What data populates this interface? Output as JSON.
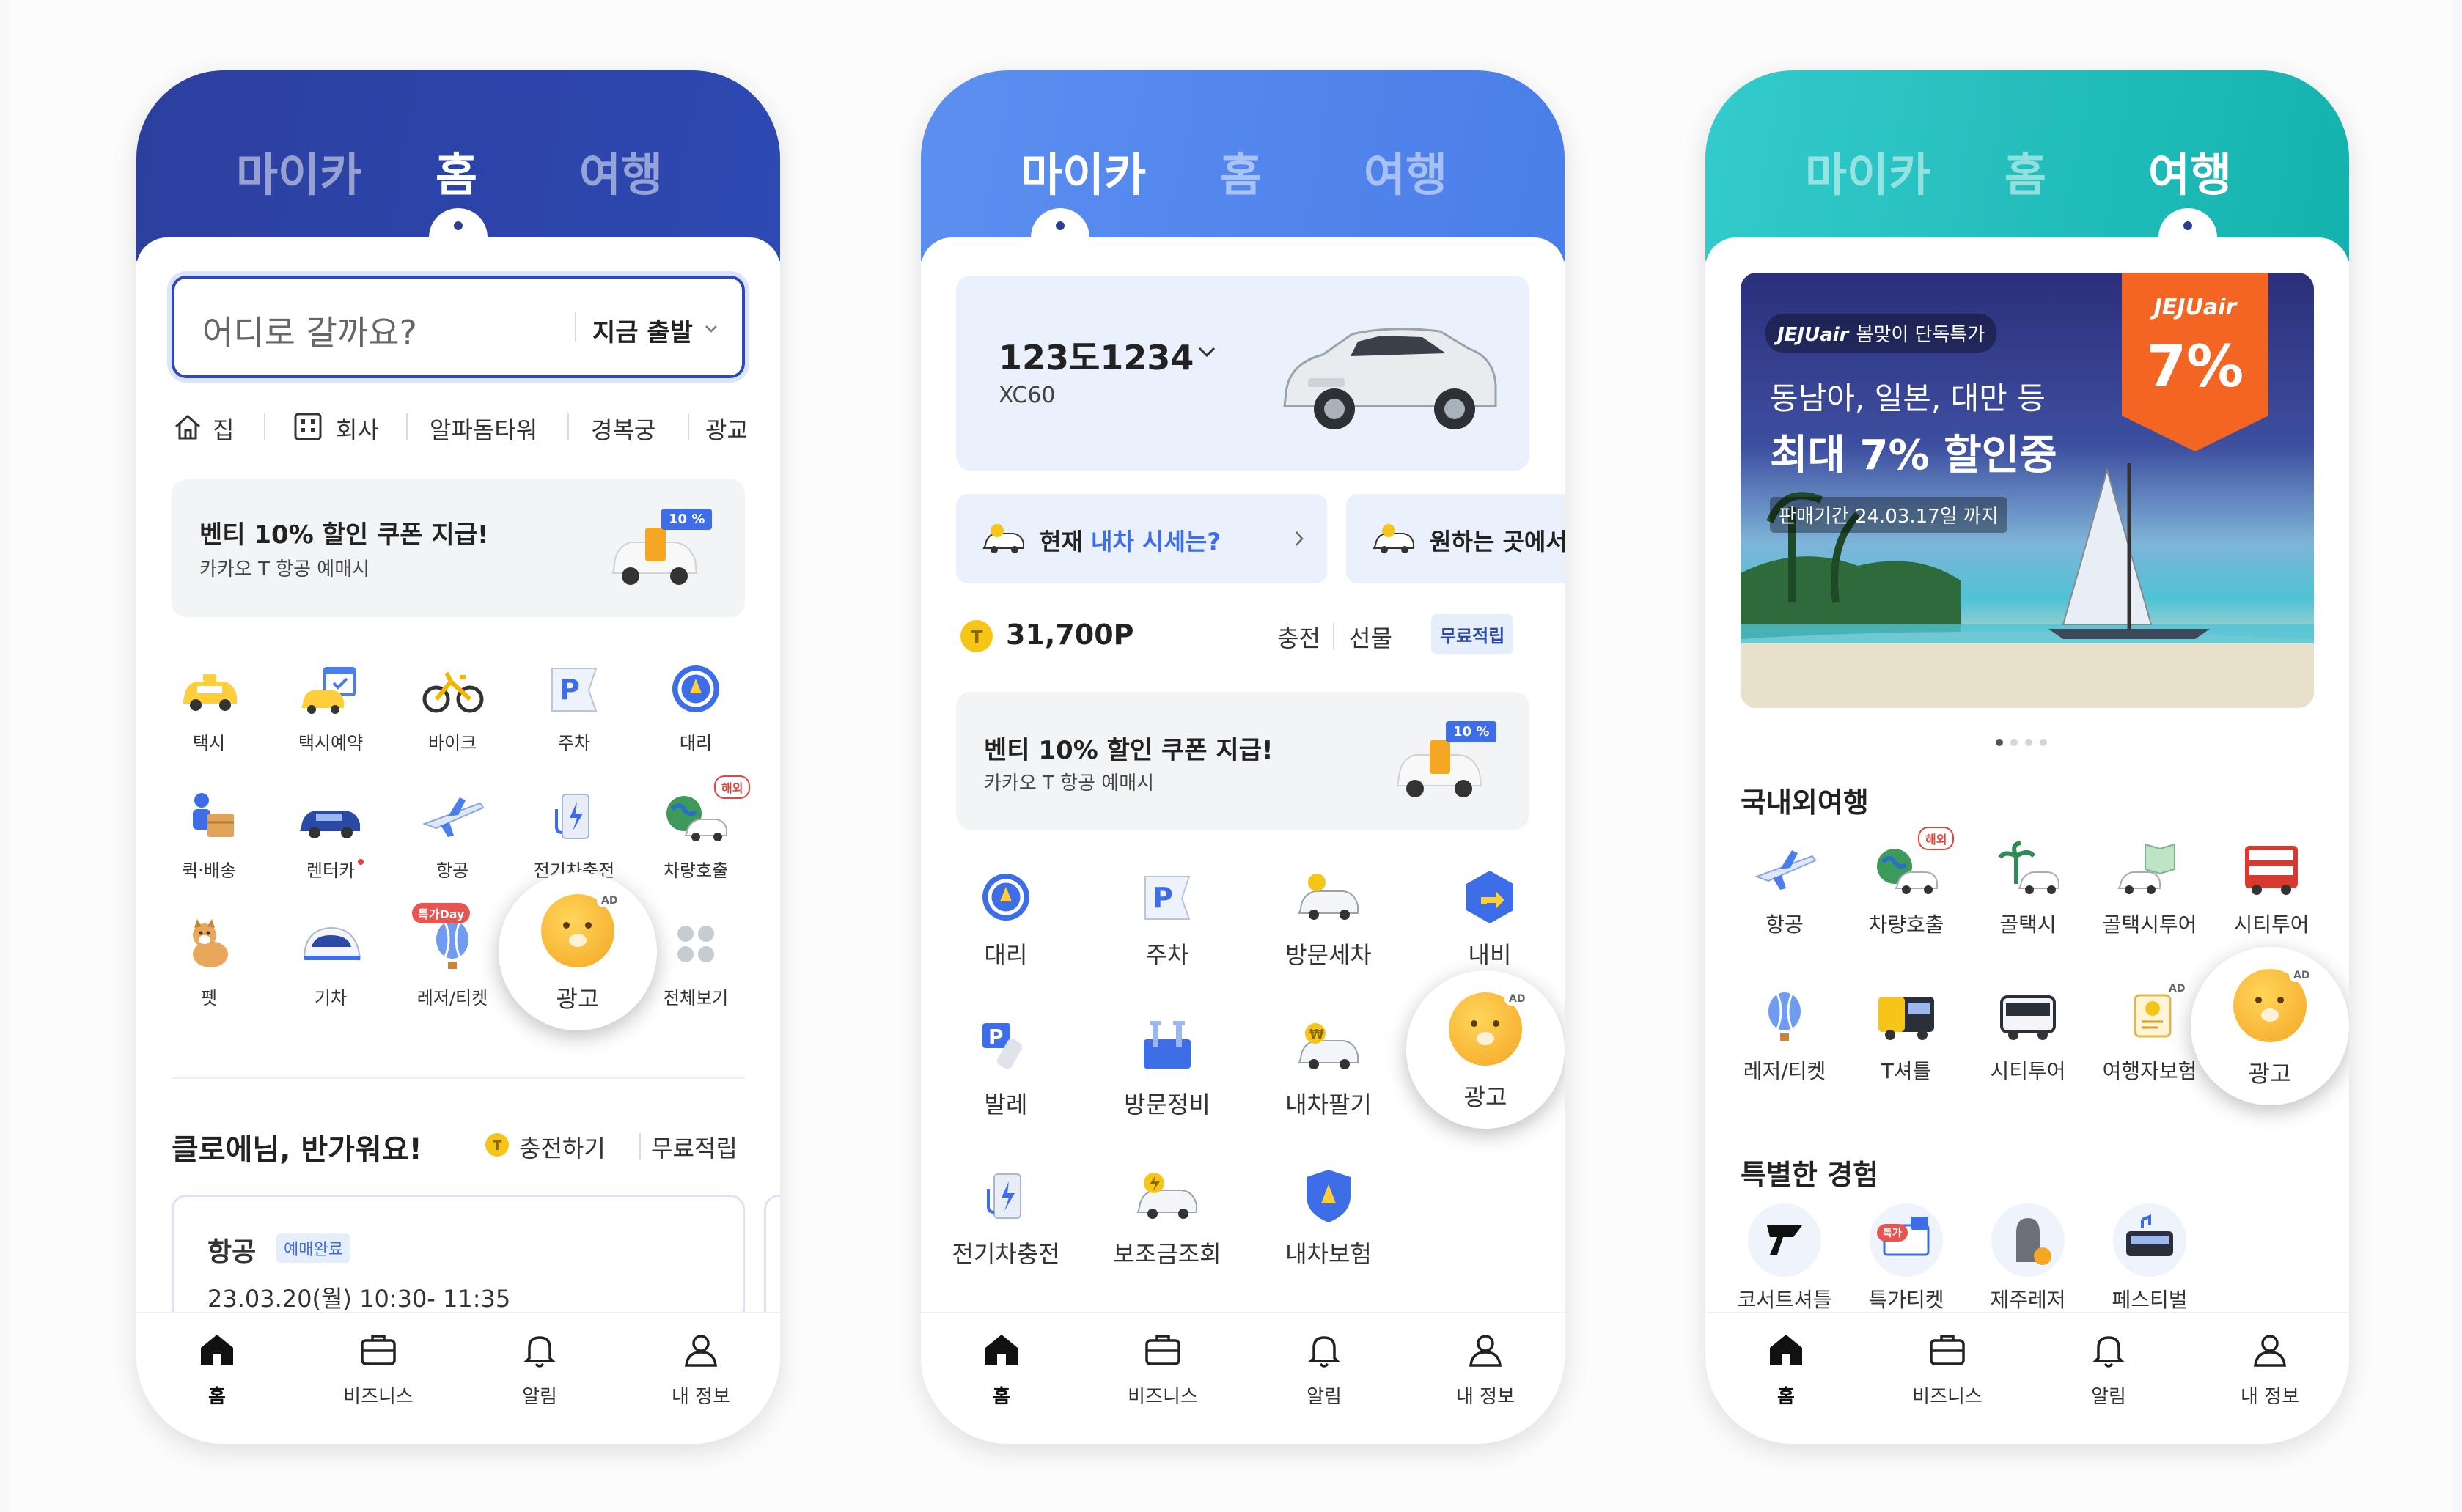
{
  "common": {
    "tabs": [
      "마이카",
      "홈",
      "여행"
    ],
    "bottom_nav": [
      "홈",
      "비즈니스",
      "알림",
      "내 정보"
    ]
  },
  "home": {
    "search": {
      "placeholder": "어디로 갈까요?",
      "depart": "지금 출발"
    },
    "quick_places": [
      "집",
      "회사",
      "알파돔타워",
      "경복궁",
      "광교"
    ],
    "promo": {
      "title": "벤티 10% 할인 쿠폰 지급!",
      "subtitle": "카카오 T 항공 예매시",
      "badge": "10 %"
    },
    "grid": [
      [
        "택시",
        "택시예약",
        "바이크",
        "주차",
        "대리"
      ],
      [
        "퀵·배송",
        "렌터카",
        "항공",
        "전기차충전",
        "차량호출"
      ],
      [
        "펫",
        "기차",
        "레저/티켓",
        "광고",
        "전체보기"
      ]
    ],
    "badges": {
      "overseas": "해외",
      "special_day": "특가Day",
      "ad": "AD"
    },
    "greeting": "클로에님, 반가워요!",
    "charge": "충전하기",
    "free_points": "무료적립",
    "booking": {
      "type": "항공",
      "status": "예매완료",
      "datetime": "23.03.20(월) 10:30- 11:35"
    }
  },
  "mycar": {
    "car": {
      "plate": "123도1234",
      "model": "XC60"
    },
    "banners": [
      {
        "prefix": "현재 ",
        "highlight": "내차 시세는?",
        "suffix": ""
      },
      {
        "prefix": "원하는 곳에서 ",
        "highlight": "",
        "suffix": ""
      }
    ],
    "points": "31,700P",
    "point_actions": [
      "충전",
      "선물"
    ],
    "free_points": "무료적립",
    "promo": {
      "title": "벤티 10% 할인 쿠폰 지급!",
      "subtitle": "카카오 T 항공 예매시",
      "badge": "10 %"
    },
    "grid": [
      [
        "대리",
        "주차",
        "방문세차",
        "내비"
      ],
      [
        "발레",
        "방문정비",
        "내차팔기",
        "광고"
      ],
      [
        "전기차충전",
        "보조금조회",
        "내차보험"
      ]
    ],
    "ad": "AD"
  },
  "travel": {
    "banner": {
      "brand": "JEJUair",
      "tag": "봄맞이 단독특가",
      "line1": "동남아, 일본, 대만 등",
      "line2": "최대 7% 할인중",
      "period": "판매기간 24.03.17일 까지",
      "ribbon_brand": "JEJUair",
      "ribbon_pct": "7%"
    },
    "section1": "국내외여행",
    "grid": [
      [
        "항공",
        "차량호출",
        "골택시",
        "골택시투어",
        "시티투어"
      ],
      [
        "레저/티켓",
        "T셔틀",
        "시티투어",
        "여행자보험",
        "광고"
      ]
    ],
    "section2": "특별한 경험",
    "experiences": [
      "코서트셔틀",
      "특가티켓",
      "제주레저",
      "페스티벌"
    ],
    "badges": {
      "overseas": "해외",
      "special": "특가",
      "ad": "AD"
    }
  },
  "colors": {
    "home_header": "#2e49b3",
    "mycar_header": "#4a7ee8",
    "travel_header": "#14b2ad",
    "accent": "#3d6ee8"
  }
}
